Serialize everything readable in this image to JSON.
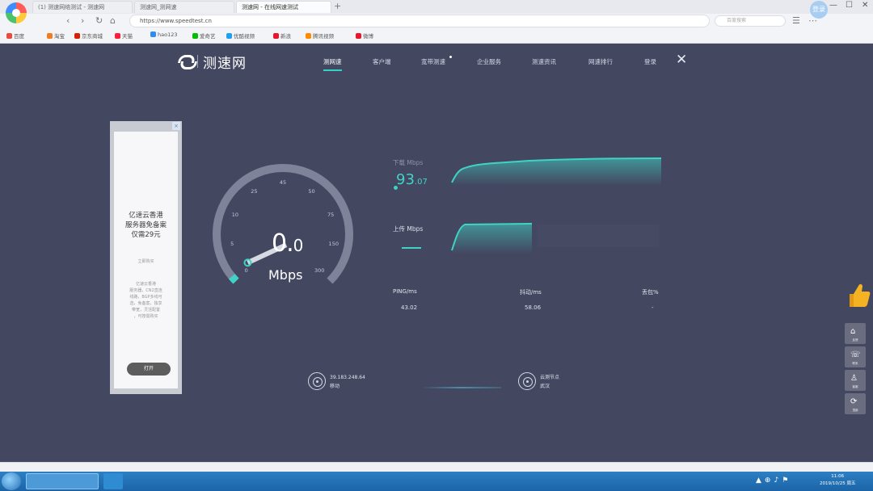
{
  "browser": {
    "tabs": [
      {
        "label": "(1) 测速网络测试 - 测速网",
        "active": false
      },
      {
        "label": "测速网_测网速",
        "active": false
      },
      {
        "label": "测速网 - 在线网速测试",
        "active": true
      }
    ],
    "new_tab": "+",
    "user_avatar": "登录",
    "window_buttons": [
      "—",
      "☐",
      "✕"
    ],
    "nav_icons": [
      "back-icon",
      "forward-icon",
      "refresh-icon",
      "home-icon",
      "favorite-icon"
    ],
    "address": "https://www.speedtest.cn",
    "search_placeholder": "百度搜索",
    "bookmarks": [
      "百度",
      "淘宝",
      "京东商城",
      "天猫",
      "hao123",
      "爱奇艺",
      "优酷视频",
      "新浪",
      "腾讯视频",
      "微博"
    ]
  },
  "site": {
    "name": "测速网",
    "menu": [
      "测网速",
      "客户端",
      "宽带测速",
      "企业服务",
      "测速资讯",
      "网速排行",
      "登录"
    ],
    "active_menu_index": 0,
    "close": "✕"
  },
  "ad": {
    "close": "×",
    "title_lines": [
      "亿速云香港",
      "服务器免备案",
      "仅需29元"
    ],
    "subtitle": "立即购买",
    "desc_lines": [
      "亿速云香港",
      "服务器，CN2直连",
      "线路，BGP多线可",
      "选，免备案，独享",
      "带宽，灵活配置",
      "，可按需购买"
    ],
    "button": "打开"
  },
  "gauge": {
    "ticks": [
      "0",
      "5",
      "10",
      "25",
      "45",
      "50",
      "75",
      "150",
      "300"
    ],
    "value_int": "0.",
    "value_dec": "0",
    "unit": "Mbps",
    "needle_fraction": 0.0
  },
  "download": {
    "label": "下载 Mbps",
    "value_int": "93",
    "value_dec": ".07"
  },
  "upload": {
    "label": "上传 Mbps"
  },
  "stats": [
    {
      "label": "PING/ms",
      "value": "43.02"
    },
    {
      "label": "抖动/ms",
      "value": "58.06"
    },
    {
      "label": "丢包%",
      "value": "-"
    }
  ],
  "server": {
    "left_lines": [
      "39.183.248.64",
      "移动"
    ],
    "right_lines": [
      "云测节点",
      "武汉"
    ]
  },
  "side_tools": [
    {
      "icon": "feedback-icon",
      "label": "反馈"
    },
    {
      "icon": "phone-icon",
      "label": "联系"
    },
    {
      "icon": "user-icon",
      "label": "客服"
    },
    {
      "icon": "top-icon",
      "label": "顶部"
    }
  ],
  "taskbar": {
    "tray_icons": [
      "▲",
      "⊕",
      "♪",
      "⚑"
    ],
    "time": "11:06",
    "date": "2019/10/25 周五"
  }
}
